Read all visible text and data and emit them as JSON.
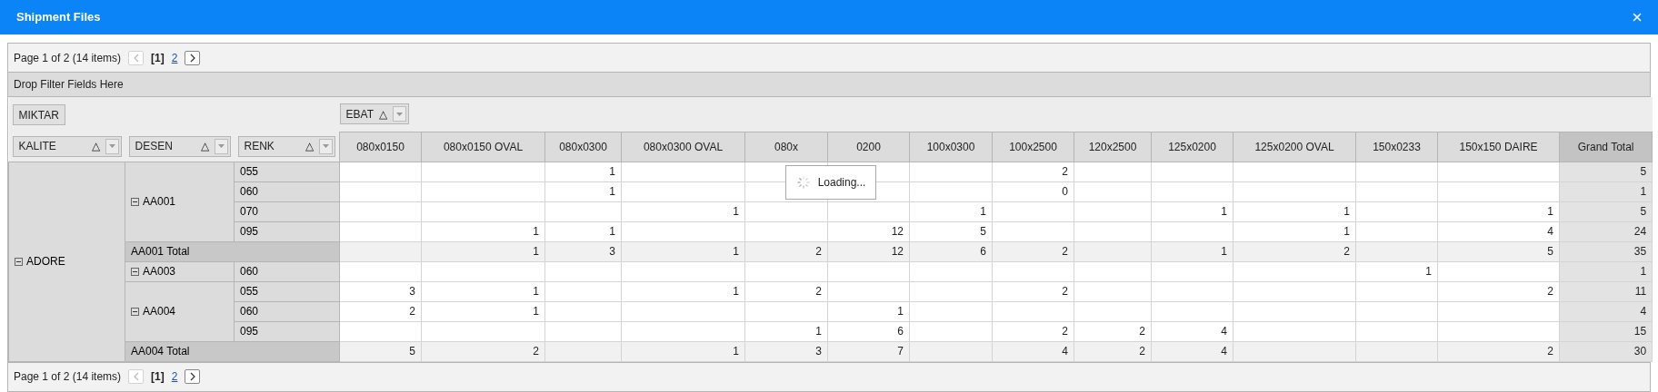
{
  "window": {
    "title": "Shipment Files"
  },
  "pager_top": {
    "summary": "Page 1 of 2 (14 items)",
    "prev_disabled": true,
    "next_disabled": false,
    "pages": [
      {
        "label": "[1]",
        "selected": true
      },
      {
        "label": "2",
        "selected": false
      }
    ]
  },
  "filter_area": {
    "text": "Drop Filter Fields Here"
  },
  "data_fields": [
    {
      "label": "MIKTAR"
    }
  ],
  "column_fields": [
    {
      "label": "EBAT",
      "sort_mark": "△"
    }
  ],
  "row_fields": [
    {
      "label": "KALITE",
      "sort_mark": "△"
    },
    {
      "label": "DESEN",
      "sort_mark": "△"
    },
    {
      "label": "RENK",
      "sort_mark": "△"
    }
  ],
  "columns": [
    {
      "label": "080x0150"
    },
    {
      "label": "080x0150 OVAL"
    },
    {
      "label": "080x0300"
    },
    {
      "label": "080x0300 OVAL"
    },
    {
      "label": "080x"
    },
    {
      "label": "0200"
    },
    {
      "label": "100x0300"
    },
    {
      "label": "100x2500"
    },
    {
      "label": "120x2500"
    },
    {
      "label": "125x0200"
    },
    {
      "label": "125x0200 OVAL"
    },
    {
      "label": "150x0233"
    },
    {
      "label": "150x150 DAIRE"
    },
    {
      "label": "Grand Total",
      "kind": "grand_total"
    }
  ],
  "groups": [
    {
      "label": "ADORE",
      "expanded": true,
      "children": [
        {
          "label": "AA001",
          "expanded": true,
          "rows": [
            {
              "label": "055",
              "cells": [
                null,
                null,
                "1",
                null,
                null,
                null,
                null,
                "2",
                null,
                null,
                null,
                null,
                null,
                "5"
              ]
            },
            {
              "label": "060",
              "cells": [
                null,
                null,
                "1",
                null,
                null,
                null,
                null,
                "0",
                null,
                null,
                null,
                null,
                null,
                "1"
              ]
            },
            {
              "label": "070",
              "cells": [
                null,
                null,
                null,
                "1",
                null,
                null,
                "1",
                null,
                null,
                "1",
                "1",
                null,
                "1",
                "5"
              ]
            },
            {
              "label": "095",
              "cells": [
                null,
                "1",
                "1",
                null,
                null,
                "12",
                "5",
                null,
                null,
                null,
                "1",
                null,
                "4",
                "24"
              ]
            }
          ],
          "total": {
            "label": "AA001 Total",
            "cells": [
              null,
              "1",
              "3",
              "1",
              "2",
              "12",
              "6",
              "2",
              null,
              "1",
              "2",
              null,
              "5",
              "35"
            ]
          }
        },
        {
          "label": "AA003",
          "expanded": true,
          "rows": [
            {
              "label": "060",
              "cells": [
                null,
                null,
                null,
                null,
                null,
                null,
                null,
                null,
                null,
                null,
                null,
                "1",
                null,
                "1"
              ]
            }
          ]
        },
        {
          "label": "AA004",
          "expanded": true,
          "rows": [
            {
              "label": "055",
              "cells": [
                "3",
                "1",
                null,
                "1",
                "2",
                null,
                null,
                "2",
                null,
                null,
                null,
                null,
                "2",
                "11"
              ]
            },
            {
              "label": "060",
              "cells": [
                "2",
                "1",
                null,
                null,
                null,
                "1",
                null,
                null,
                null,
                null,
                null,
                null,
                null,
                "4"
              ]
            },
            {
              "label": "095",
              "cells": [
                null,
                null,
                null,
                null,
                "1",
                "6",
                null,
                "2",
                "2",
                "4",
                null,
                null,
                null,
                "15"
              ]
            }
          ],
          "total": {
            "label": "AA004 Total",
            "cells": [
              "5",
              "2",
              null,
              "1",
              "3",
              "7",
              null,
              "4",
              "2",
              "4",
              null,
              null,
              "2",
              "30"
            ]
          }
        }
      ]
    }
  ],
  "pager_bottom": {
    "summary": "Page 1 of 2 (14 items)",
    "prev_disabled": true,
    "next_disabled": false,
    "pages": [
      {
        "label": "[1]",
        "selected": true
      },
      {
        "label": "2",
        "selected": false
      }
    ]
  },
  "loading": {
    "text": "Loading..."
  }
}
